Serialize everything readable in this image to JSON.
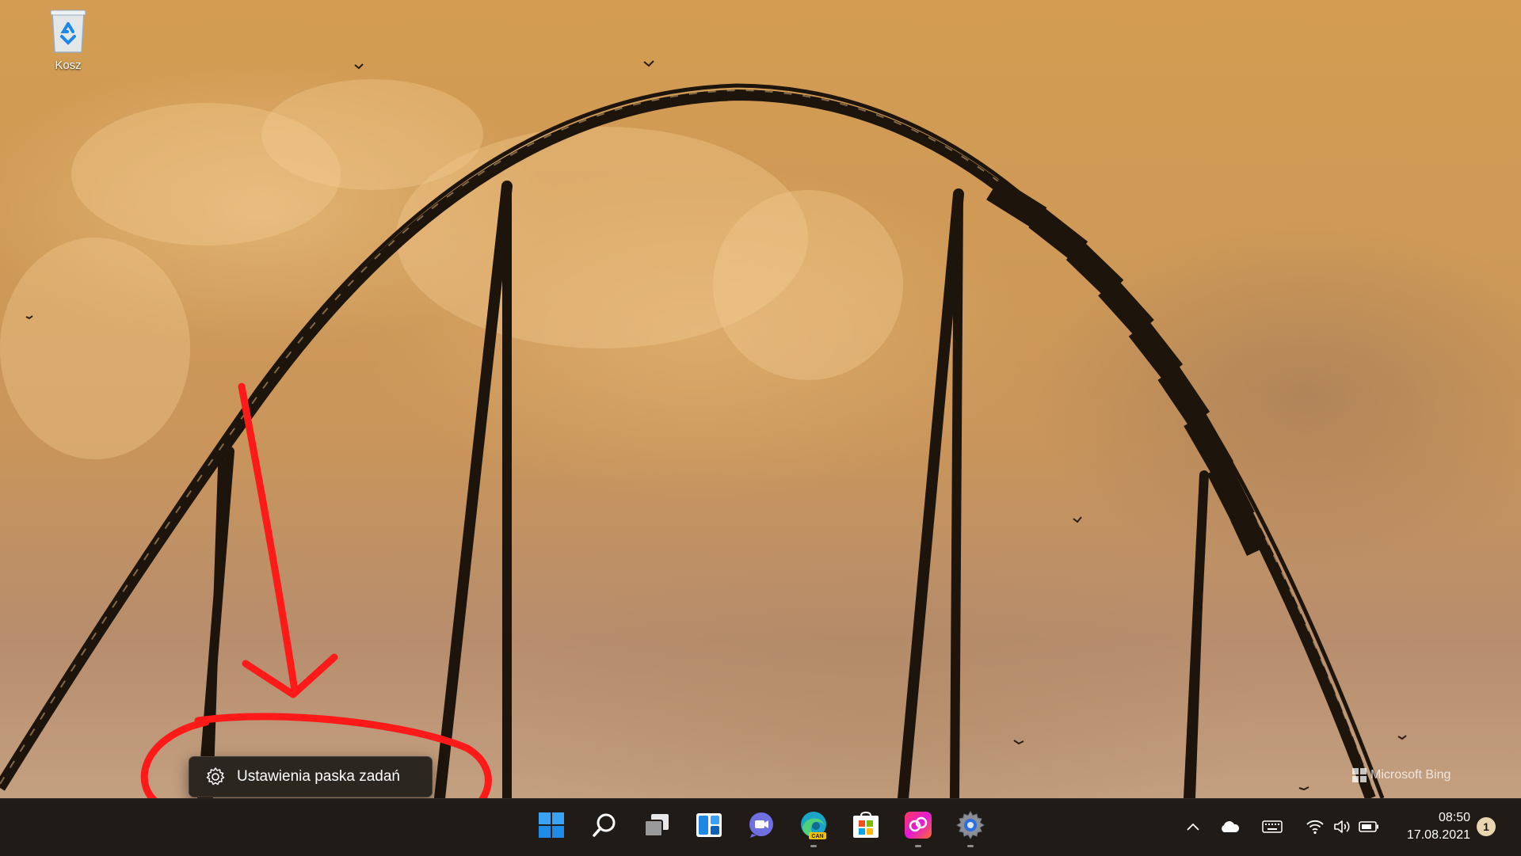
{
  "desktop": {
    "icons": [
      {
        "label": "Kosz",
        "icon": "recycle-bin-icon"
      }
    ],
    "watermark": "Microsoft Bing"
  },
  "context_menu": {
    "items": [
      {
        "label": "Ustawienia paska zadań",
        "icon": "gear-icon"
      }
    ]
  },
  "annotation": {
    "color": "#ff1a1a"
  },
  "taskbar": {
    "apps": [
      {
        "name": "Start",
        "icon": "windows-start-icon"
      },
      {
        "name": "Search",
        "icon": "search-icon"
      },
      {
        "name": "Task View",
        "icon": "task-view-icon"
      },
      {
        "name": "Widgets",
        "icon": "widgets-icon"
      },
      {
        "name": "Chat",
        "icon": "chat-icon"
      },
      {
        "name": "Edge Canary",
        "icon": "edge-canary-icon",
        "badge": "CAN"
      },
      {
        "name": "Microsoft Store",
        "icon": "store-icon"
      },
      {
        "name": "Creative Cloud",
        "icon": "creative-cloud-icon"
      },
      {
        "name": "Settings",
        "icon": "settings-icon"
      }
    ],
    "tray": {
      "icons": [
        "chevron-up-icon",
        "onedrive-cloud-icon",
        "keyboard-icon",
        "wifi-icon",
        "volume-icon",
        "battery-icon"
      ],
      "time": "08:50",
      "date": "17.08.2021",
      "notifications": "1"
    }
  }
}
